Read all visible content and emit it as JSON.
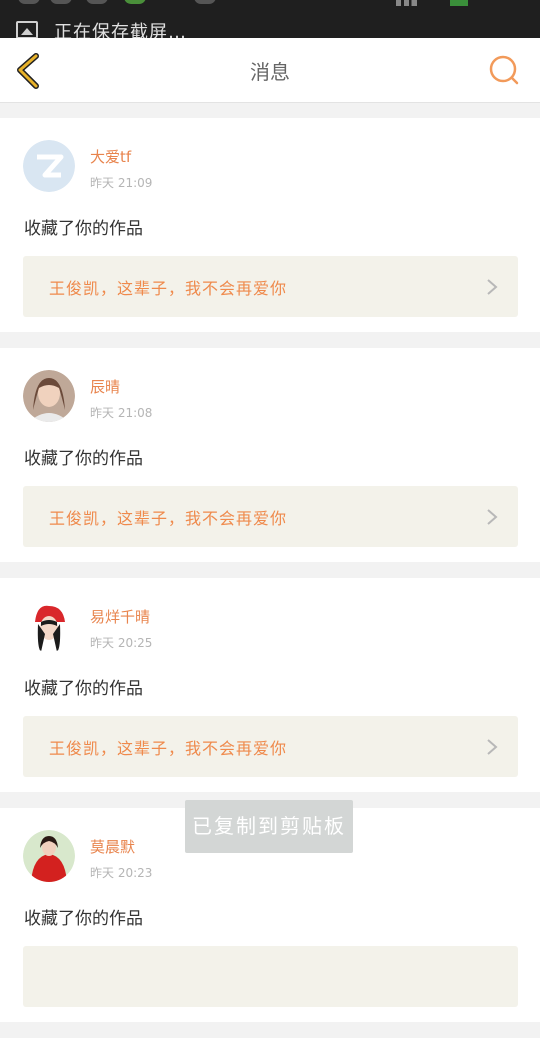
{
  "status": {
    "notification_text": "正在保存截屏…"
  },
  "header": {
    "title": "消息",
    "icons": {
      "back": "chevron-left-icon",
      "search": "search-icon"
    },
    "accent_color": "#e8b22a"
  },
  "messages": [
    {
      "user": "大爱tf",
      "time": "昨天 21:09",
      "action": "收藏了你的作品",
      "work_title": "王俊凯，这辈子，我不会再爱你",
      "avatar": "default-avatar-icon"
    },
    {
      "user": "辰晴",
      "time": "昨天 21:08",
      "action": "收藏了你的作品",
      "work_title": "王俊凯，这辈子，我不会再爱你",
      "avatar": "photo-avatar"
    },
    {
      "user": "易烊千晴",
      "time": "昨天 20:25",
      "action": "收藏了你的作品",
      "work_title": "王俊凯，这辈子，我不会再爱你",
      "avatar": "photo-avatar"
    },
    {
      "user": "莫晨默",
      "time": "昨天 20:23",
      "action": "收藏了你的作品",
      "work_title": "",
      "avatar": "photo-avatar"
    }
  ],
  "toast": "已复制到剪贴板",
  "colors": {
    "username": "#e8844d",
    "quote_bg": "#f3f2ea",
    "quote_text": "#ef8a4c"
  }
}
